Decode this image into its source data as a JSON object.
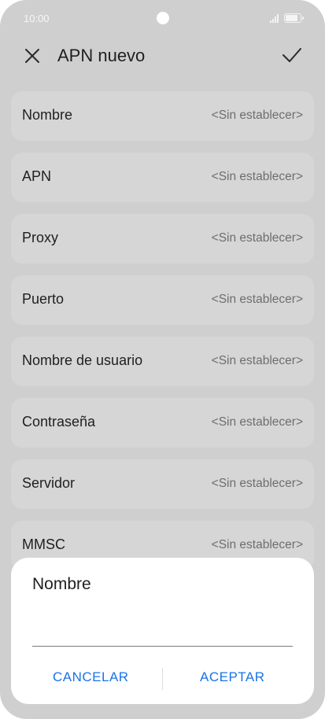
{
  "status_bar": {
    "time": "10:00",
    "icons": [
      "camera-punch-hole",
      "signal-icon",
      "battery-icon"
    ]
  },
  "header": {
    "title": "APN nuevo",
    "close_icon": "close-icon",
    "confirm_icon": "check-icon"
  },
  "fields": [
    {
      "label": "Nombre",
      "value": "<Sin establecer>"
    },
    {
      "label": "APN",
      "value": "<Sin establecer>"
    },
    {
      "label": "Proxy",
      "value": "<Sin establecer>"
    },
    {
      "label": "Puerto",
      "value": "<Sin establecer>"
    },
    {
      "label": "Nombre de usuario",
      "value": "<Sin establecer>"
    },
    {
      "label": "Contraseña",
      "value": "<Sin establecer>"
    },
    {
      "label": "Servidor",
      "value": "<Sin establecer>"
    },
    {
      "label": "MMSC",
      "value": "<Sin establecer>"
    }
  ],
  "dialog": {
    "title": "Nombre",
    "input_value": "",
    "cancel_label": "CANCELAR",
    "accept_label": "ACEPTAR"
  },
  "colors": {
    "accent": "#1a73e8",
    "background": "#cfcfcf",
    "row": "#d6d6d6",
    "dialog": "#ffffff"
  }
}
